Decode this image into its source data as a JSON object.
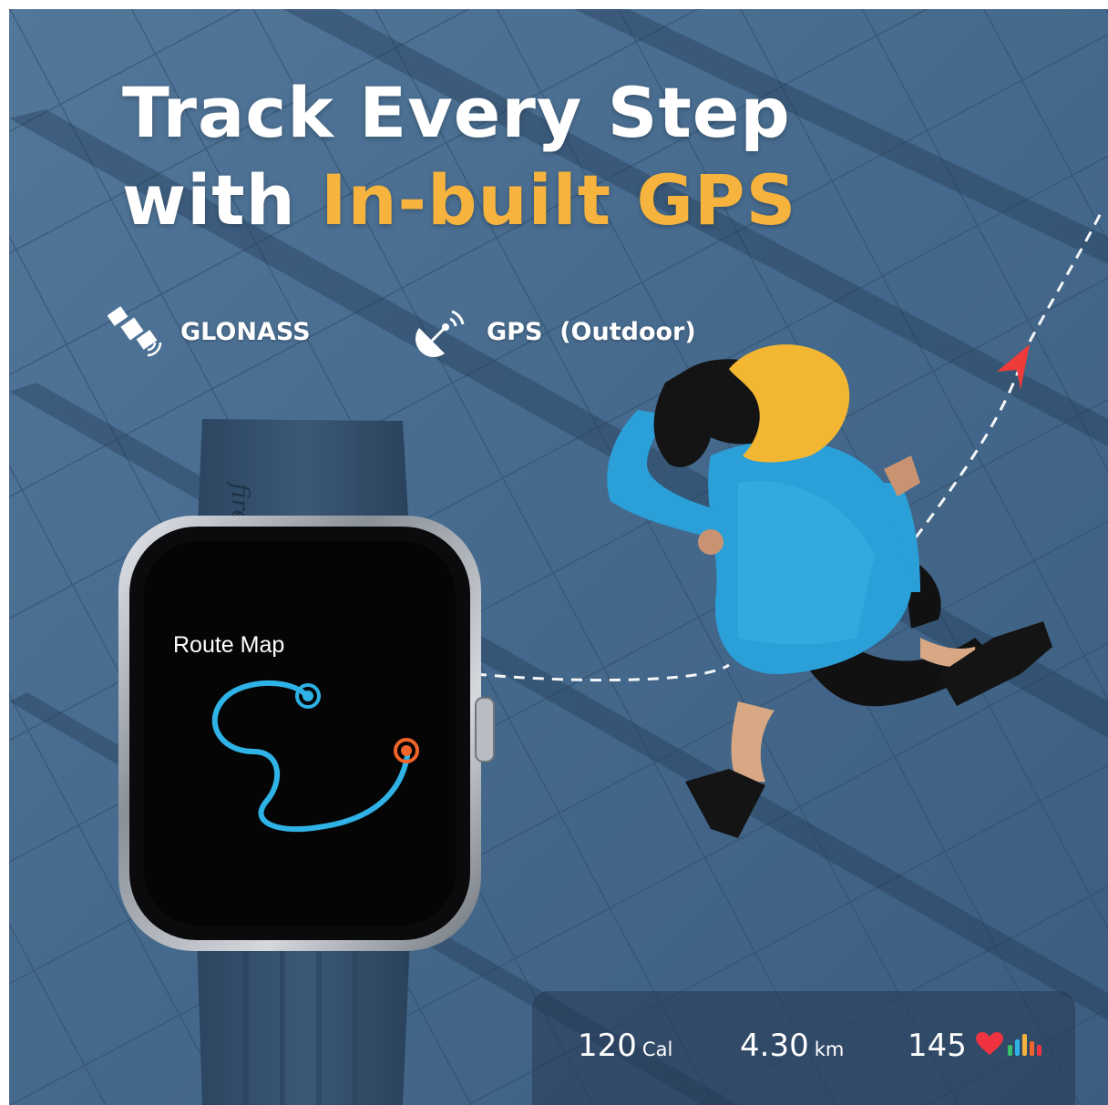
{
  "headline": {
    "line1": "Track Every Step",
    "line2_prefix": "with",
    "line2_accent": "In-built GPS"
  },
  "features": [
    {
      "icon": "satellite-icon",
      "label": "GLONASS"
    },
    {
      "icon": "gps-dish-icon",
      "label": "GPS  (Outdoor)"
    }
  ],
  "watch": {
    "band_brand": "fire",
    "screen_title": "Route Map"
  },
  "stats": {
    "calories": {
      "value": "120",
      "unit": "Cal"
    },
    "distance": {
      "value": "4.30",
      "unit": "km"
    },
    "heart_rate": {
      "value": "145"
    }
  },
  "colors": {
    "accent": "#f6b33d",
    "route": "#2fb2e6",
    "start_dot": "#2fb2e6",
    "end_dot": "#f2642a",
    "heart": "#ef3340",
    "cap": "#f2b632",
    "jacket": "#2a9fd8"
  }
}
